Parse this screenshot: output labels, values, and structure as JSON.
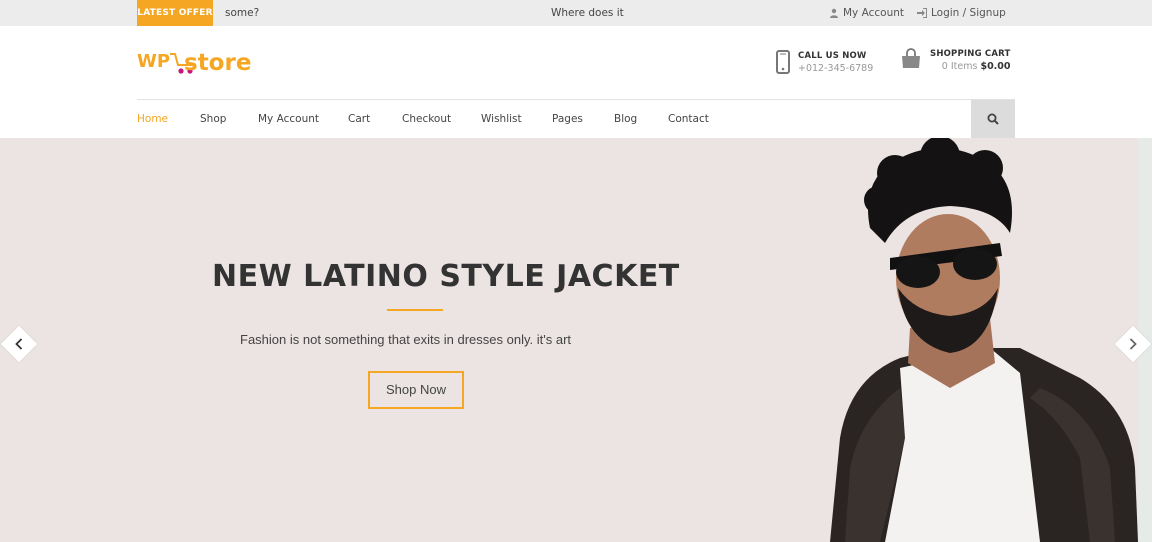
{
  "topbar": {
    "badge": "LATEST OFFER",
    "ticker_1": "some?",
    "ticker_2": "Where does it co",
    "my_account": "My Account",
    "login": "Login / Signup"
  },
  "header": {
    "logo_text_1": "WP",
    "logo_text_2": "store",
    "call_title": "CALL US NOW",
    "call_number": "+012-345-6789",
    "cart_title": "SHOPPING CART",
    "cart_items": "0 Items",
    "cart_total": "$0.00"
  },
  "nav": {
    "items": [
      {
        "label": "Home",
        "active": true
      },
      {
        "label": "Shop"
      },
      {
        "label": "My Account"
      },
      {
        "label": "Cart"
      },
      {
        "label": "Checkout"
      },
      {
        "label": "Wishlist"
      },
      {
        "label": "Pages"
      },
      {
        "label": "Blog"
      },
      {
        "label": "Contact"
      }
    ],
    "search_icon": "search-icon"
  },
  "hero": {
    "title": "NEW LATINO STYLE JACKET",
    "subtitle": "Fashion is not something that exits in  dresses only. it's art",
    "button": "Shop Now"
  },
  "colors": {
    "accent": "#f5a623",
    "logo_dark_accent": "#c8157a",
    "hero_bg": "#ebe4e3",
    "topbar_bg": "#ececec"
  }
}
